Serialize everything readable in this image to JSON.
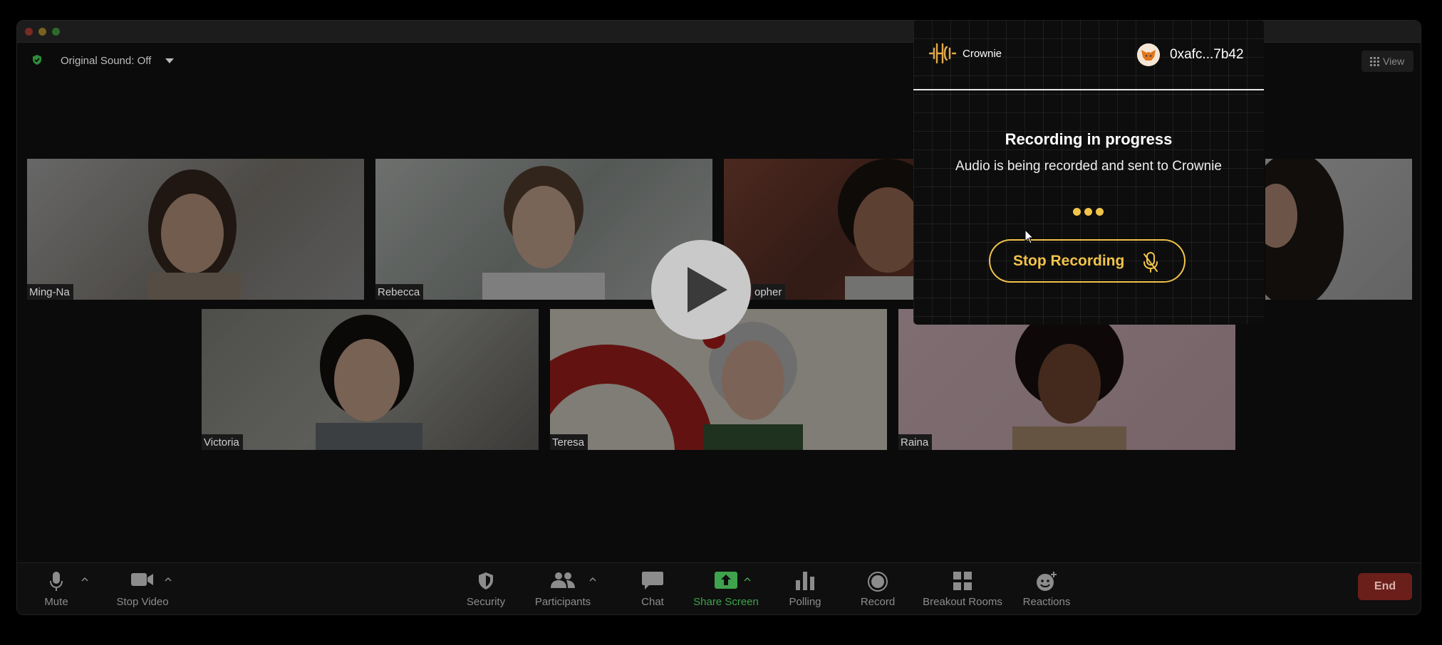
{
  "topbar": {
    "original_sound": "Original Sound: Off",
    "view_label": "View"
  },
  "participants": [
    "Ming-Na",
    "Rebecca",
    "opher",
    "Victoria",
    "Teresa",
    "Raina"
  ],
  "crownie": {
    "brand": "Crownie",
    "wallet": "0xafc...7b42",
    "title": "Recording in progress",
    "subtitle": "Audio is being recorded and sent to Crownie",
    "stop_label": "Stop Recording",
    "accent": "#f2c34b"
  },
  "toolbar": {
    "mute": "Mute",
    "stop_video": "Stop Video",
    "security": "Security",
    "participants": "Participants",
    "chat": "Chat",
    "share_screen": "Share Screen",
    "polling": "Polling",
    "record": "Record",
    "breakout_rooms": "Breakout Rooms",
    "reactions": "Reactions",
    "end": "End",
    "share_color": "#3fa34d"
  }
}
